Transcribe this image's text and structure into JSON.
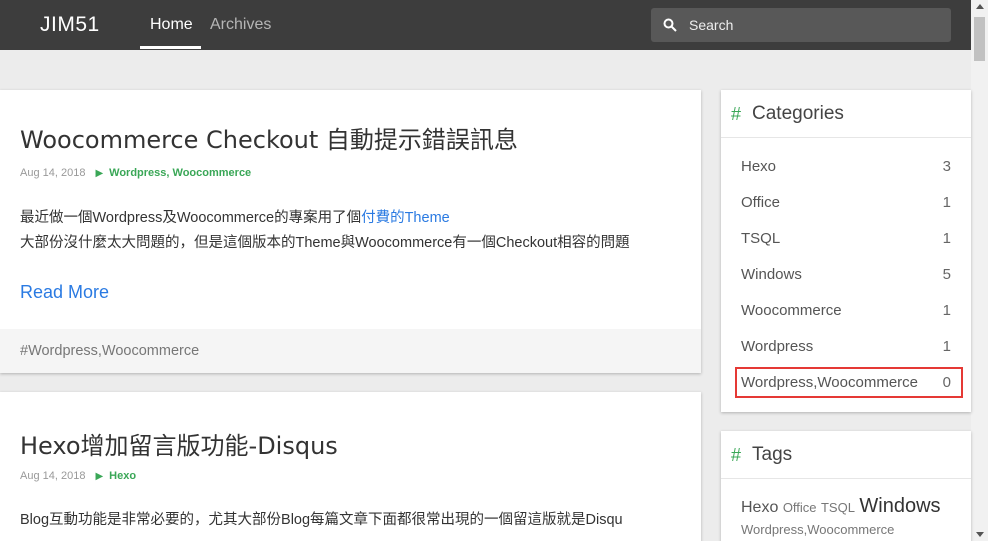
{
  "header": {
    "brand": "JIM51",
    "nav": [
      {
        "label": "Home",
        "active": true
      },
      {
        "label": "Archives",
        "active": false
      }
    ],
    "search": {
      "placeholder": "Search",
      "icon": "search-icon"
    },
    "background": "#3d3d3d"
  },
  "posts": [
    {
      "title": "Woocommerce Checkout 自動提示錯誤訊息",
      "date": "Aug 14, 2018",
      "categories": "Wordpress, Woocommerce",
      "excerpt_line1_prefix": "最近做一個Wordpress及Woocommerce的專案用了個",
      "excerpt_line1_link": "付費的Theme",
      "excerpt_line2": "大部份沒什麼太大問題的，但是這個版本的Theme與Woocommerce有一個Checkout相容的問題",
      "read_more": "Read More",
      "tags": "#Wordpress,Woocommerce"
    },
    {
      "title": "Hexo增加留言版功能-Disqus",
      "date": "Aug 14, 2018",
      "categories": "Hexo",
      "excerpt_line1": "Blog互動功能是非常必要的，尤其大部份Blog每篇文章下面都很常出現的一個留這版就是Disqu"
    }
  ],
  "sidebar": {
    "categories": {
      "hash": "#",
      "title": "Categories",
      "items": [
        {
          "name": "Hexo",
          "count": "3"
        },
        {
          "name": "Office",
          "count": "1"
        },
        {
          "name": "TSQL",
          "count": "1"
        },
        {
          "name": "Windows",
          "count": "5"
        },
        {
          "name": "Woocommerce",
          "count": "1"
        },
        {
          "name": "Wordpress",
          "count": "1"
        },
        {
          "name": "Wordpress,Woocommerce",
          "count": "0"
        }
      ]
    },
    "tags": {
      "hash": "#",
      "title": "Tags",
      "cloud": [
        "Hexo",
        "Office",
        "TSQL",
        "Windows",
        "Wordpress,Woocommerce"
      ]
    }
  },
  "colors": {
    "accent_green": "#3aa757",
    "link_blue": "#2a7ae2",
    "highlight_red": "#e53935"
  }
}
